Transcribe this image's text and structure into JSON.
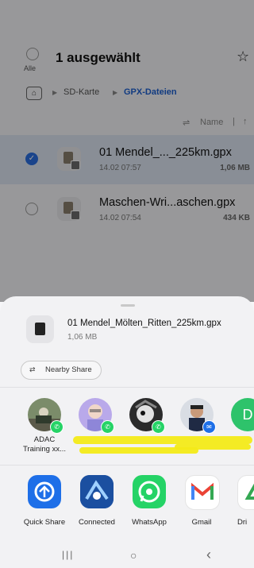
{
  "header": {
    "all_label": "Alle",
    "title": "1 ausgewählt",
    "star_icon": "☆"
  },
  "breadcrumb": {
    "home_icon": "⌂",
    "items": [
      "SD-Karte",
      "GPX-Dateien"
    ]
  },
  "sort": {
    "icon": "⇌",
    "label": "Name",
    "separator": "|",
    "direction": "↑"
  },
  "files": [
    {
      "name": "01 Mendel_..._225km.gpx",
      "date": "14.02 07:57",
      "size": "1,06 MB",
      "selected": true
    },
    {
      "name": "Maschen-Wri...aschen.gpx",
      "date": "14.02 07:54",
      "size": "434 KB",
      "selected": false
    }
  ],
  "share_sheet": {
    "file_name": "01 Mendel_Mölten_Ritten_225km.gpx",
    "file_size": "1,06 MB",
    "nearby_share_label": "Nearby Share",
    "nearby_share_icon": "⇄",
    "contacts": [
      {
        "name": "ADAC Training xx..."
      },
      {
        "name": ""
      },
      {
        "name": ""
      },
      {
        "name": ""
      },
      {
        "name": "D"
      }
    ],
    "apps": [
      {
        "name": "Quick Share",
        "icon": "quick-share-icon",
        "color": "#1e6fe8"
      },
      {
        "name": "Connected",
        "icon": "connected-icon",
        "color": "#1b4fa0"
      },
      {
        "name": "WhatsApp",
        "icon": "whatsapp-icon",
        "color": "#25d366"
      },
      {
        "name": "Gmail",
        "icon": "gmail-icon",
        "color": "#ea4335"
      },
      {
        "name": "Dri",
        "icon": "drive-icon",
        "color": "#34a853"
      }
    ]
  },
  "nav": {
    "recents_icon": "|||",
    "home_icon": "○",
    "back_icon": "‹"
  }
}
